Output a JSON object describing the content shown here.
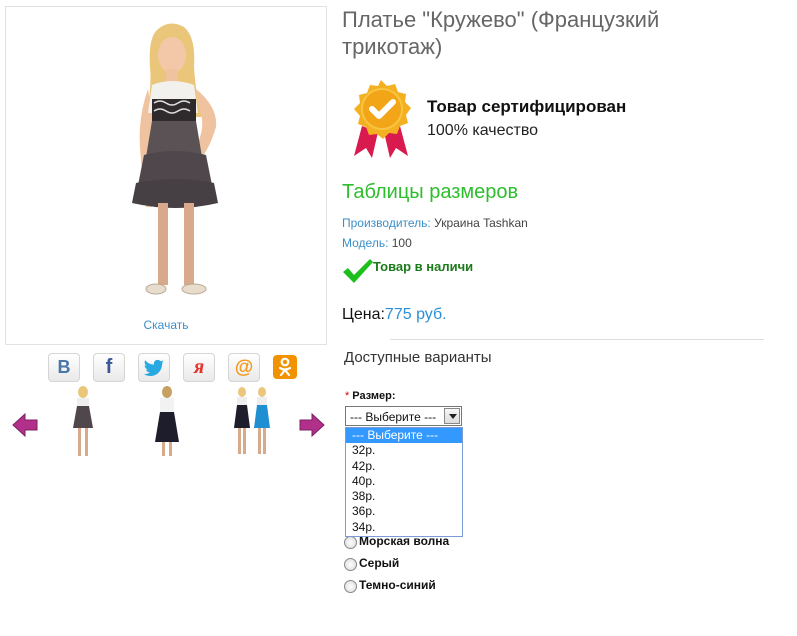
{
  "product": {
    "title": "Платье \"Кружево\" (Французкий трикотаж)",
    "download_label": "Скачать"
  },
  "certificate": {
    "title": "Товар сертифицирован",
    "subtitle": "100% качество",
    "icon": "certified-badge-icon",
    "colors": {
      "badge": "#f5b021",
      "ribbon": "#d81a4f"
    }
  },
  "size_tables_link": "Таблицы размеров",
  "manufacturer": {
    "label": "Производитель:",
    "value": "Украина Tashkan"
  },
  "model": {
    "label": "Модель:",
    "value": "100"
  },
  "stock": {
    "text": "Товар в наличи",
    "icon": "checkmark-icon"
  },
  "price": {
    "label": "Цена:",
    "value": "775 руб."
  },
  "variants": {
    "title": "Доступные варианты",
    "size_label": "Размер:",
    "required_mark": "*",
    "selected": "--- Выберите ---",
    "options": [
      "--- Выберите ---",
      "32р.",
      "42р.",
      "40р.",
      "38р.",
      "36р.",
      "34р."
    ],
    "colors": [
      "Морская волна",
      "Серый",
      "Темно-синий"
    ]
  },
  "social": [
    {
      "name": "vk",
      "glyph": "В",
      "color": "#4a76a8"
    },
    {
      "name": "facebook",
      "glyph": "f",
      "color": "#3b5998"
    },
    {
      "name": "twitter",
      "glyph": "twitter-bird-icon",
      "color": "#29a9e1"
    },
    {
      "name": "yaru",
      "glyph": "я",
      "color": "#e4352a"
    },
    {
      "name": "mailru",
      "glyph": "@",
      "color": "#f29a1d"
    },
    {
      "name": "odnoklassniki",
      "glyph": "ok-icon",
      "color": "#f39200"
    }
  ],
  "colors": {
    "accent_link": "#3a8fc8",
    "green": "#2dbd2d",
    "arrow": "#b0308a"
  }
}
